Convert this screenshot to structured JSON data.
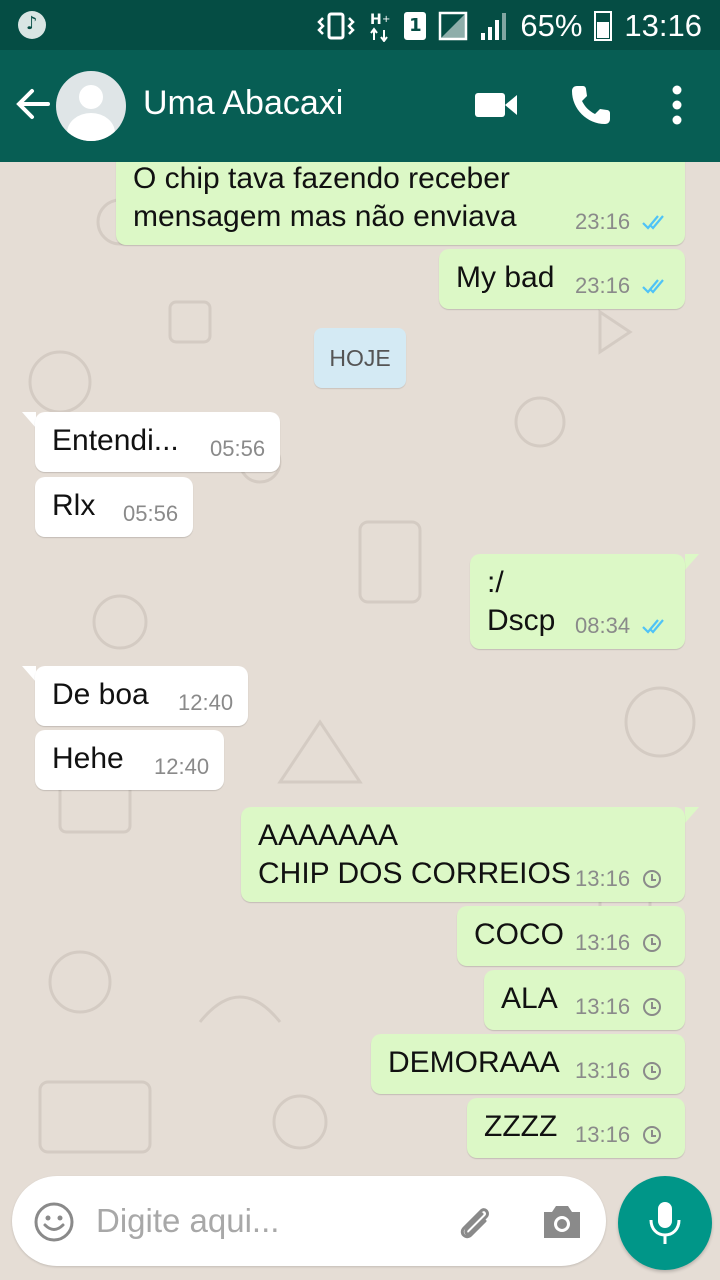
{
  "status_bar": {
    "battery_percent": "65%",
    "time": "13:16",
    "sim_slot": "1",
    "icons": [
      "music-icon",
      "vibrate-icon",
      "data-icon",
      "sim-icon",
      "no-signal-icon",
      "signal-icon",
      "battery-icon"
    ]
  },
  "header": {
    "contact_name": "Uma Abacaxi",
    "icons": [
      "back-arrow-icon",
      "avatar",
      "video-call-icon",
      "phone-icon",
      "more-vert-icon"
    ]
  },
  "date_separator": "HOJE",
  "messages": [
    {
      "direction": "out",
      "text": "O chip tava fazendo receber\nmensagem mas não enviava",
      "time": "23:16",
      "status": "read"
    },
    {
      "direction": "out",
      "text": "My bad",
      "time": "23:16",
      "status": "read"
    },
    {
      "direction": "in",
      "text": "Entendi...",
      "time": "05:56"
    },
    {
      "direction": "in",
      "text": "Rlx",
      "time": "05:56"
    },
    {
      "direction": "out",
      "text": ":/\nDscp",
      "time": "08:34",
      "status": "read"
    },
    {
      "direction": "in",
      "text": "De boa",
      "time": "12:40"
    },
    {
      "direction": "in",
      "text": "Hehe",
      "time": "12:40"
    },
    {
      "direction": "out",
      "text": "AAAAAAA\nCHIP DOS CORREIOS",
      "time": "13:16",
      "status": "pending"
    },
    {
      "direction": "out",
      "text": "COCO",
      "time": "13:16",
      "status": "pending"
    },
    {
      "direction": "out",
      "text": "ALA",
      "time": "13:16",
      "status": "pending"
    },
    {
      "direction": "out",
      "text": "DEMORAAA",
      "time": "13:16",
      "status": "pending"
    },
    {
      "direction": "out",
      "text": "ZZZZ",
      "time": "13:16",
      "status": "pending"
    }
  ],
  "input": {
    "placeholder": "Digite aqui...",
    "value": ""
  },
  "colors": {
    "status_bar": "#054d44",
    "header": "#075e54",
    "outgoing_bubble": "#dcf8c6",
    "incoming_bubble": "#ffffff",
    "read_tick": "#4fc3f7",
    "mic_button": "#009688",
    "chat_background": "#e5ddd5"
  }
}
